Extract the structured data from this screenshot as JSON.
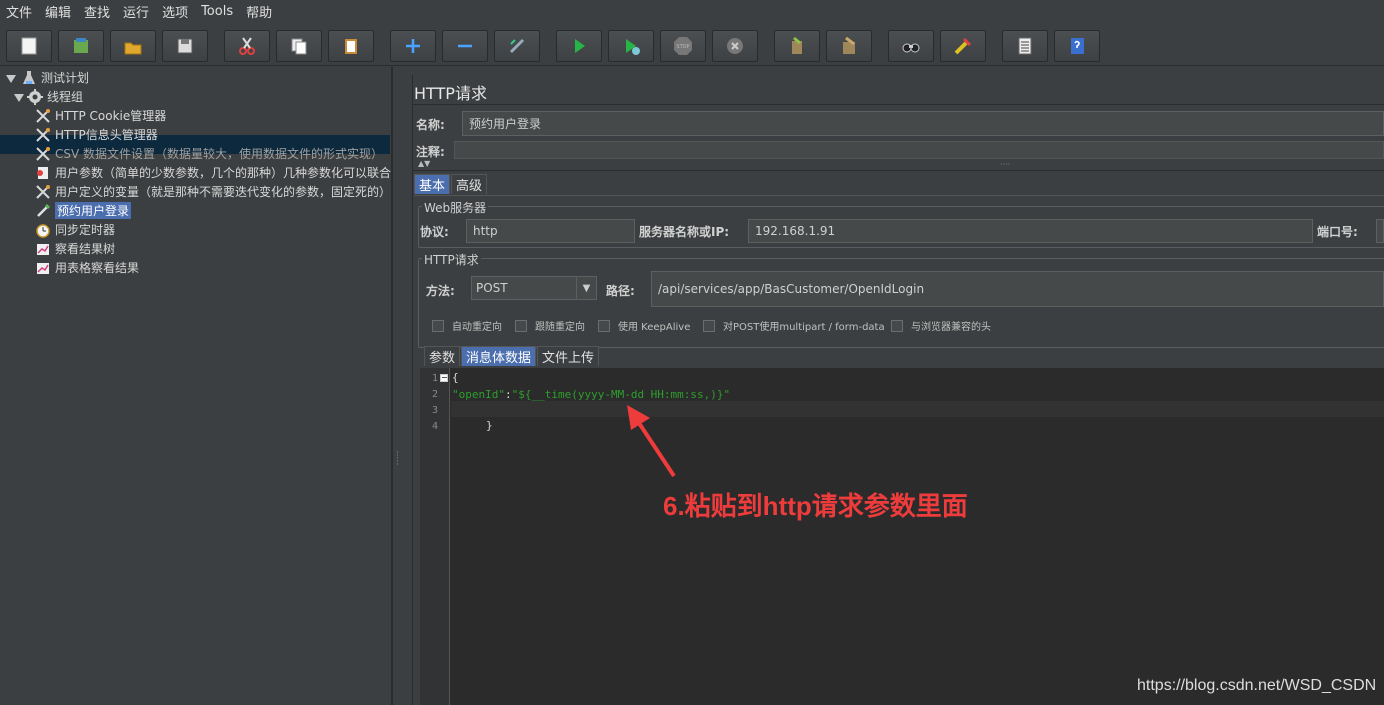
{
  "menu": [
    "文件",
    "编辑",
    "查找",
    "运行",
    "选项",
    "Tools",
    "帮助"
  ],
  "toolbar": {
    "buttons": [
      "new-icon",
      "templates-icon",
      "open-icon",
      "save-icon",
      "cut-icon",
      "copy-icon",
      "paste-icon",
      "expand-icon",
      "collapse-icon",
      "toggle-icon",
      "start-icon",
      "start-no-pause-icon",
      "stop-icon",
      "shutdown-icon",
      "clear-icon",
      "clear-all-icon",
      "search-icon",
      "reset-search-icon",
      "function-helper-icon",
      "help-icon"
    ],
    "stop_text": "STOP"
  },
  "tree": {
    "root": "测试计划",
    "thread_group": "线程组",
    "items": [
      "HTTP Cookie管理器",
      "HTTP信息头管理器",
      "CSV 数据文件设置（数据量较大，使用数据文件的形式实现）",
      "用户参数（简单的少数参数，几个的那种）几种参数化可以联合",
      "用户定义的变量（就是那种不需要迭代变化的参数，固定死的）",
      "预约用户登录",
      "同步定时器",
      "察看结果树",
      "用表格察看结果"
    ],
    "selected_index": 5
  },
  "panel": {
    "title": "HTTP请求",
    "name_label": "名称:",
    "name_value": "预约用户登录",
    "comment_label": "注释:",
    "tabs": [
      "基本",
      "高级"
    ],
    "active_tab": "基本",
    "web_server": {
      "group_title": "Web服务器",
      "protocol_label": "协议:",
      "protocol_value": "http",
      "server_label": "服务器名称或IP:",
      "server_value": "192.168.1.91",
      "port_label": "端口号:"
    },
    "http_request": {
      "group_title": "HTTP请求",
      "method_label": "方法:",
      "method_value": "POST",
      "path_label": "路径:",
      "path_value": "/api/services/app/BasCustomer/OpenIdLogin",
      "checkboxes": [
        "自动重定向",
        "跟随重定向",
        "使用 KeepAlive",
        "对POST使用multipart / form-data",
        "与浏览器兼容的头"
      ]
    },
    "body_tabs": [
      "参数",
      "消息体数据",
      "文件上传"
    ],
    "active_body_tab": "消息体数据"
  },
  "editor": {
    "line_numbers": [
      "1",
      "2",
      "3",
      "4"
    ],
    "line1": "{",
    "line2_key": "\"openId\"",
    "line2_colon": ":",
    "line2_value": "\"${__time(yyyy-MM-dd HH:mm:ss,)}\"",
    "line4": "}"
  },
  "annotation": "6.粘贴到http请求参数里面",
  "watermark": "https://blog.csdn.net/WSD_CSDN",
  "colors": {
    "background": "#3c3f41",
    "editor_bg": "#2b2b2b",
    "selection": "#4b6eaf",
    "string_green": "#2e9e2e",
    "annotation_red": "#ee3b3b"
  }
}
